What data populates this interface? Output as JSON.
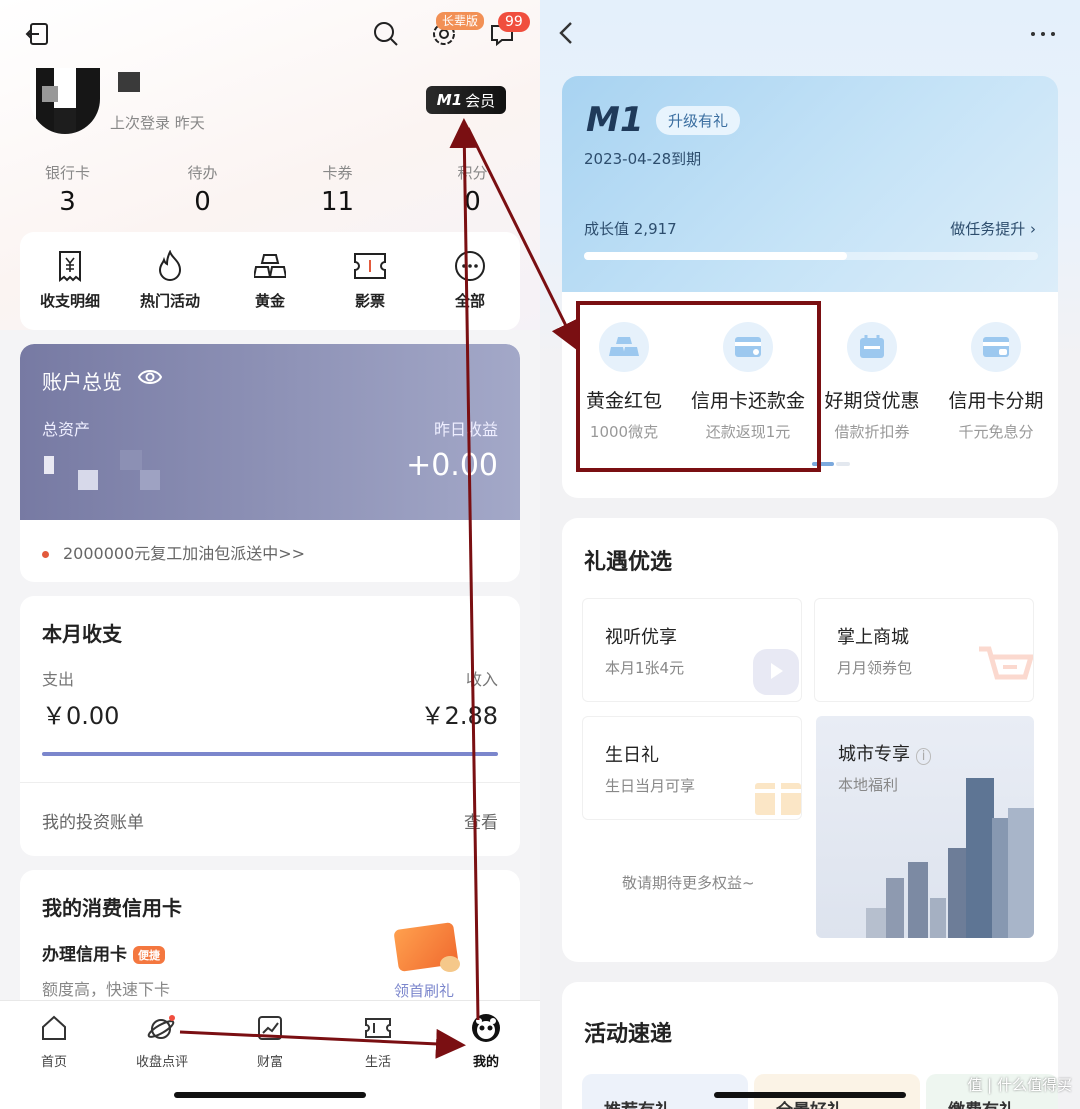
{
  "left": {
    "header": {
      "settings_badge": "长辈版",
      "message_count": "99"
    },
    "profile": {
      "last_login": "上次登录 昨天",
      "member_badge_logo": "M1",
      "member_badge_text": "会员"
    },
    "stats": [
      {
        "label": "银行卡",
        "value": "3"
      },
      {
        "label": "待办",
        "value": "0"
      },
      {
        "label": "卡券",
        "value": "11"
      },
      {
        "label": "积分",
        "value": "0"
      }
    ],
    "quick_actions": [
      {
        "label": "收支明细",
        "icon": "receipt-yen-icon"
      },
      {
        "label": "热门活动",
        "icon": "flame-icon"
      },
      {
        "label": "黄金",
        "icon": "gold-bars-icon"
      },
      {
        "label": "影票",
        "icon": "ticket-icon"
      },
      {
        "label": "全部",
        "icon": "more-circle-icon"
      }
    ],
    "account": {
      "title": "账户总览",
      "total_assets_label": "总资产",
      "yesterday_gain_label": "昨日收益",
      "yesterday_gain_value": "+0.00",
      "promo": "2000000元复工加油包派送中>>"
    },
    "month": {
      "title": "本月收支",
      "expense_label": "支出",
      "income_label": "收入",
      "expense_value": "￥0.00",
      "income_value": "￥2.88",
      "investment_label": "我的投资账单",
      "view_label": "查看"
    },
    "credit": {
      "title": "我的消费信用卡",
      "apply_label": "办理信用卡",
      "apply_tag": "便捷",
      "apply_desc": "额度高，快速下卡",
      "gift_label": "领首刷礼"
    },
    "tabbar": [
      {
        "label": "首页",
        "icon": "home-icon"
      },
      {
        "label": "收盘点评",
        "icon": "planet-icon"
      },
      {
        "label": "财富",
        "icon": "trend-chart-icon"
      },
      {
        "label": "生活",
        "icon": "coupon-icon"
      },
      {
        "label": "我的",
        "icon": "panda-avatar-icon"
      }
    ]
  },
  "right": {
    "membership": {
      "logo": "M1",
      "upgrade_tag": "升级有礼",
      "expiry": "2023-04-28到期",
      "growth_label": "成长值 2,917",
      "task_link": "做任务提升",
      "growth_progress": 0.58
    },
    "benefits": [
      {
        "title": "黄金红包",
        "sub": "1000微克",
        "icon": "gold-bars-icon"
      },
      {
        "title": "信用卡还款金",
        "sub": "还款返现1元",
        "icon": "credit-card-icon"
      },
      {
        "title": "好期贷优惠",
        "sub": "借款折扣券",
        "icon": "calendar-icon"
      },
      {
        "title": "信用卡分期",
        "sub": "千元免息分",
        "icon": "card-installment-icon"
      }
    ],
    "gifts": {
      "title": "礼遇优选",
      "tiles": [
        {
          "title": "视听优享",
          "sub": "本月1张4元"
        },
        {
          "title": "掌上商城",
          "sub": "月月领券包"
        },
        {
          "title": "生日礼",
          "sub": "生日当月可享"
        }
      ],
      "city": {
        "title": "城市专享",
        "sub": "本地福利"
      },
      "expect": "敬请期待更多权益~"
    },
    "activity": {
      "title": "活动速递",
      "tiles": [
        "推荐有礼",
        "全景好礼",
        "缴费有礼"
      ]
    },
    "watermark": "值 | 什么值得买"
  },
  "colors": {
    "accent_purple": "#7b86cc",
    "annotation_red": "#7a0f12",
    "alert_red": "#f04e3e"
  }
}
